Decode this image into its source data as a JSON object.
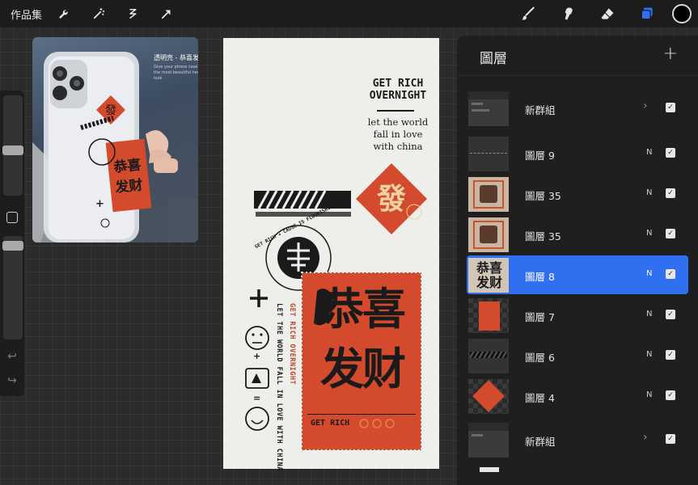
{
  "topbar": {
    "gallery_label": "作品集",
    "tools_left": [
      "wrench-icon",
      "magic-wand-icon",
      "selection-icon",
      "transform-arrow-icon"
    ],
    "tools_right": [
      "brush-icon",
      "smudge-icon",
      "eraser-icon",
      "layers-icon"
    ],
    "active_tool": "layers-icon",
    "accent_color": "#2f6ff0",
    "current_color": "#000000"
  },
  "reference": {
    "title": "透明壳 - 恭喜发",
    "subtitle": "Give your phone case the most beautiful new look"
  },
  "canvas": {
    "heading": "GET RICH OVERNIGHT",
    "tagline": "let the world fall in love with china",
    "circle_text": "GET RICH ★ CAUSE IS FLOURISHING 2023",
    "vertical_text_black": "LET THE WORLD FALL IN LOVE WITH CHINA",
    "vertical_text_red": "GET RICH OVERNIGHT",
    "diamond_char": "發",
    "ticket_chars": "恭喜发财",
    "ticket_label": "GET RICH",
    "plus_sign": "+",
    "equals_sign": "="
  },
  "layers": {
    "title": "圖層",
    "add_icon": "+",
    "rows": [
      {
        "name": "新群組",
        "type": "group",
        "checked": true
      },
      {
        "name": "圖層 9",
        "mode": "N",
        "checked": true
      },
      {
        "name": "圖層 35",
        "mode": "N",
        "checked": true
      },
      {
        "name": "圖層 35",
        "mode": "N",
        "checked": true
      },
      {
        "name": "圖層 8",
        "mode": "N",
        "checked": true,
        "selected": true
      },
      {
        "name": "圖層 7",
        "mode": "N",
        "checked": true
      },
      {
        "name": "圖層 6",
        "mode": "N",
        "checked": true
      },
      {
        "name": "圖層 4",
        "mode": "N",
        "checked": true
      },
      {
        "name": "新群組",
        "type": "group",
        "checked": true
      }
    ]
  }
}
